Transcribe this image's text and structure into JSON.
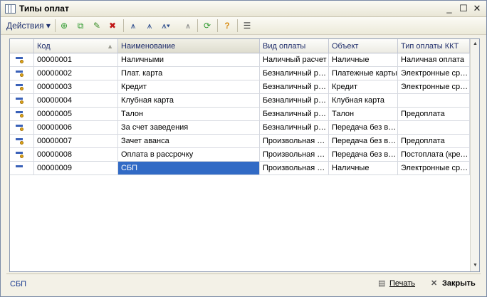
{
  "window": {
    "title": "Типы оплат"
  },
  "toolbar": {
    "actions_label": "Действия"
  },
  "grid": {
    "columns": [
      "Код",
      "Наименование",
      "Вид оплаты",
      "Объект",
      "Тип оплаты ККТ"
    ],
    "rows": [
      {
        "code": "00000001",
        "name": "Наличными",
        "kind": "Наличный расчет",
        "object": "Наличные",
        "kkt": "Наличная оплата"
      },
      {
        "code": "00000002",
        "name": "Плат. карта",
        "kind": "Безналичный расчет",
        "object": "Платежные карты",
        "kkt": "Электронные средства"
      },
      {
        "code": "00000003",
        "name": "Кредит",
        "kind": "Безналичный расчет",
        "object": "Кредит",
        "kkt": "Электронные средства"
      },
      {
        "code": "00000004",
        "name": "Клубная карта",
        "kind": "Безналичный расчет",
        "object": "Клубная карта",
        "kkt": ""
      },
      {
        "code": "00000005",
        "name": "Талон",
        "kind": "Безналичный расчет",
        "object": "Талон",
        "kkt": "Предоплата"
      },
      {
        "code": "00000006",
        "name": "За счет заведения",
        "kind": "Безналичный расчет",
        "object": "Передача без выручки",
        "kkt": ""
      },
      {
        "code": "00000007",
        "name": "Зачет аванса",
        "kind": "Произвольная оплата",
        "object": "Передача без выручки",
        "kkt": "Предоплата"
      },
      {
        "code": "00000008",
        "name": "Оплата в рассрочку",
        "kind": "Произвольная оплата",
        "object": "Передача без выручки",
        "kkt": "Постоплата (кредит)"
      },
      {
        "code": "00000009",
        "name": "СБП",
        "kind": "Произвольная оплата",
        "object": "Наличные",
        "kkt": "Электронные средства"
      }
    ]
  },
  "footer": {
    "current_item": "СБП",
    "print_label": "Печать",
    "close_label": "Закрыть"
  }
}
